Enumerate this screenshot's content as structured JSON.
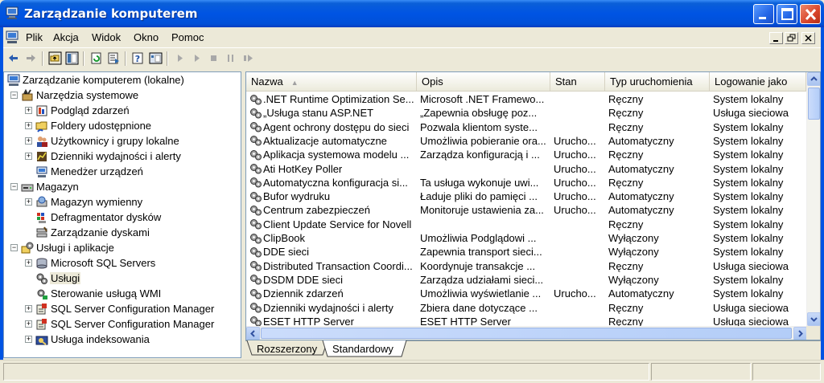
{
  "window": {
    "title": "Zarządzanie komputerem"
  },
  "menu": {
    "items": [
      "Plik",
      "Akcja",
      "Widok",
      "Okno",
      "Pomoc"
    ]
  },
  "tree": {
    "items": [
      {
        "label": "Zarządzanie komputerem (lokalne)",
        "icon": "computer-icon"
      },
      {
        "label": "Narzędzia systemowe",
        "icon": "tools-icon"
      },
      {
        "label": "Podgląd zdarzeń",
        "icon": "event-viewer-icon"
      },
      {
        "label": "Foldery udostępnione",
        "icon": "shared-folder-icon"
      },
      {
        "label": "Użytkownicy i grupy lokalne",
        "icon": "users-icon"
      },
      {
        "label": "Dzienniki wydajności i alerty",
        "icon": "performance-icon"
      },
      {
        "label": "Menedżer urządzeń",
        "icon": "device-manager-icon"
      },
      {
        "label": "Magazyn",
        "icon": "storage-icon"
      },
      {
        "label": "Magazyn wymienny",
        "icon": "removable-storage-icon"
      },
      {
        "label": "Defragmentator dysków",
        "icon": "defrag-icon"
      },
      {
        "label": "Zarządzanie dyskami",
        "icon": "disk-management-icon"
      },
      {
        "label": "Usługi i aplikacje",
        "icon": "services-apps-icon"
      },
      {
        "label": "Microsoft SQL Servers",
        "icon": "sql-servers-icon"
      },
      {
        "label": "Usługi",
        "icon": "services-icon"
      },
      {
        "label": "Sterowanie usługą WMI",
        "icon": "wmi-icon"
      },
      {
        "label": "SQL Server Configuration Manager",
        "icon": "sql-config-icon"
      },
      {
        "label": "SQL Server Configuration Manager",
        "icon": "sql-config-icon"
      },
      {
        "label": "Usługa indeksowania",
        "icon": "indexing-icon"
      }
    ]
  },
  "list": {
    "columns": [
      "Nazwa",
      "Opis",
      "Stan",
      "Typ uruchomienia",
      "Logowanie jako"
    ],
    "rows": [
      [
        ".NET Runtime Optimization Se...",
        "Microsoft .NET Framewo...",
        "",
        "Ręczny",
        "System lokalny"
      ],
      [
        "„Usługa stanu ASP.NET",
        "„Zapewnia obsługę poz...",
        "",
        "Ręczny",
        "Usługa sieciowa"
      ],
      [
        "Agent ochrony dostępu do sieci",
        "Pozwala klientom syste...",
        "",
        "Ręczny",
        "System lokalny"
      ],
      [
        "Aktualizacje automatyczne",
        "Umożliwia pobieranie ora...",
        "Urucho...",
        "Automatyczny",
        "System lokalny"
      ],
      [
        "Aplikacja systemowa modelu ...",
        "Zarządza konfiguracją i ...",
        "Urucho...",
        "Ręczny",
        "System lokalny"
      ],
      [
        "Ati HotKey Poller",
        "",
        "Urucho...",
        "Automatyczny",
        "System lokalny"
      ],
      [
        "Automatyczna konfiguracja si...",
        "Ta usługa wykonuje uwi...",
        "Urucho...",
        "Ręczny",
        "System lokalny"
      ],
      [
        "Bufor wydruku",
        "Ładuje pliki do pamięci ...",
        "Urucho...",
        "Automatyczny",
        "System lokalny"
      ],
      [
        "Centrum zabezpieczeń",
        "Monitoruje ustawienia za...",
        "Urucho...",
        "Automatyczny",
        "System lokalny"
      ],
      [
        "Client Update Service for Novell",
        "",
        "",
        "Ręczny",
        "System lokalny"
      ],
      [
        "ClipBook",
        "Umożliwia Podglądowi ...",
        "",
        "Wyłączony",
        "System lokalny"
      ],
      [
        "DDE sieci",
        "Zapewnia transport sieci...",
        "",
        "Wyłączony",
        "System lokalny"
      ],
      [
        "Distributed Transaction Coordi...",
        "Koordynuje transakcje ...",
        "",
        "Ręczny",
        "Usługa sieciowa"
      ],
      [
        "DSDM DDE sieci",
        "Zarządza udziałami sieci...",
        "",
        "Wyłączony",
        "System lokalny"
      ],
      [
        "Dziennik zdarzeń",
        "Umożliwia wyświetlanie ...",
        "Urucho...",
        "Automatyczny",
        "System lokalny"
      ],
      [
        "Dzienniki wydajności i alerty",
        "Zbiera dane dotyczące ...",
        "",
        "Ręczny",
        "Usługa sieciowa"
      ],
      [
        "ESET HTTP Server",
        "ESET HTTP Server",
        "",
        "Ręczny",
        "Usługa sieciowa"
      ]
    ]
  },
  "tabs": [
    "Rozszerzony",
    "Standardowy"
  ],
  "active_tab": "Standardowy",
  "colors": {
    "titlebar": "#0054e3",
    "face": "#ece9d8",
    "selection": "#ece9d8"
  }
}
